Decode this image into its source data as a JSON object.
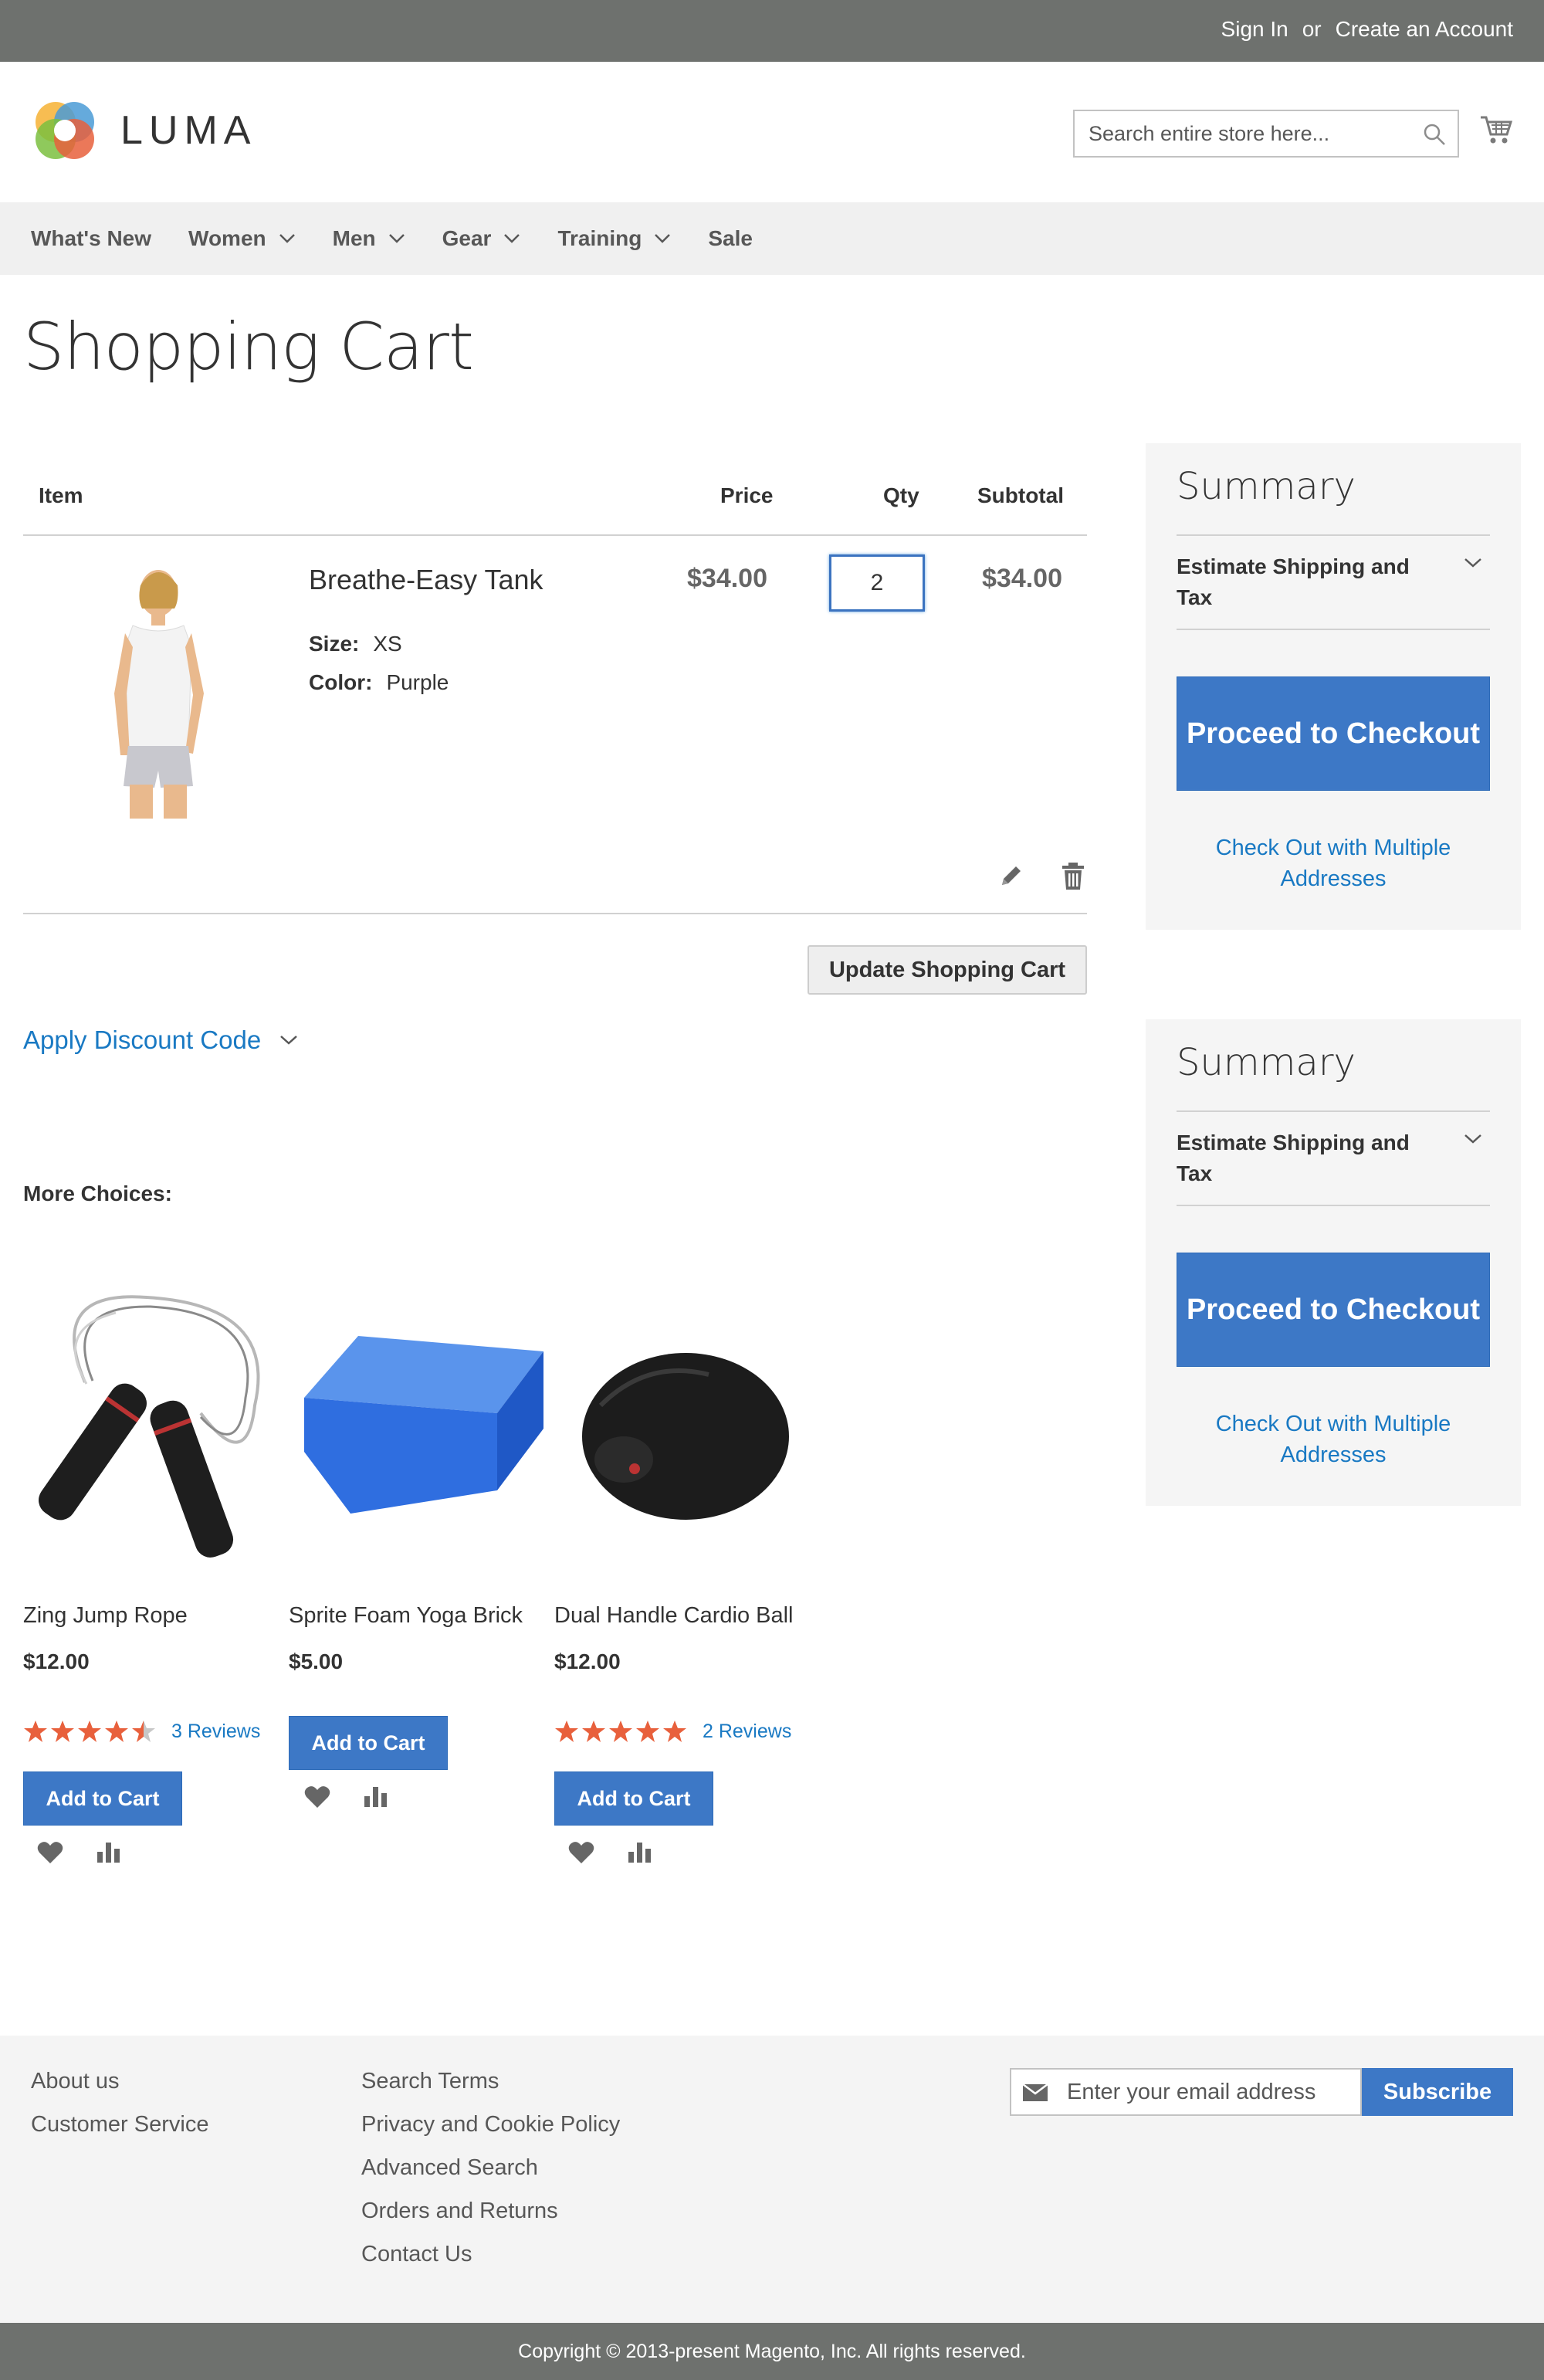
{
  "top_bar": {
    "sign_in": "Sign In",
    "or": "or",
    "create_account": "Create an Account"
  },
  "header": {
    "logo_text": "LUMA",
    "search": {
      "placeholder": "Search entire store here..."
    }
  },
  "nav": {
    "items": [
      {
        "label": "What's New",
        "has_dropdown": false
      },
      {
        "label": "Women",
        "has_dropdown": true
      },
      {
        "label": "Men",
        "has_dropdown": true
      },
      {
        "label": "Gear",
        "has_dropdown": true
      },
      {
        "label": "Training",
        "has_dropdown": true
      },
      {
        "label": "Sale",
        "has_dropdown": false
      }
    ]
  },
  "page": {
    "title": "Shopping Cart"
  },
  "cart": {
    "columns": {
      "item": "Item",
      "price": "Price",
      "qty": "Qty",
      "subtotal": "Subtotal"
    },
    "items": [
      {
        "name": "Breathe-Easy Tank",
        "price": "$34.00",
        "qty": "2",
        "subtotal": "$34.00",
        "options": [
          {
            "label": "Size:",
            "value": "XS"
          },
          {
            "label": "Color:",
            "value": "Purple"
          }
        ]
      }
    ],
    "update_button": "Update Shopping Cart",
    "discount_label": "Apply Discount Code"
  },
  "summary": [
    {
      "title": "Summary",
      "shipping_label": "Estimate Shipping and Tax",
      "checkout_button": "Proceed to Checkout",
      "multi_address_link": "Check Out with Multiple Addresses"
    },
    {
      "title": "Summary",
      "shipping_label": "Estimate Shipping and Tax",
      "checkout_button": "Proceed to Checkout",
      "multi_address_link": "Check Out with Multiple Addresses"
    }
  ],
  "more_choices": {
    "title": "More Choices:",
    "products": [
      {
        "name": "Zing Jump Rope",
        "price": "$12.00",
        "rating_stars": 4.5,
        "reviews": "3 Reviews",
        "add_to_cart": "Add to Cart"
      },
      {
        "name": "Sprite Foam Yoga Brick",
        "price": "$5.00",
        "rating_stars": null,
        "reviews": null,
        "add_to_cart": "Add to Cart"
      },
      {
        "name": "Dual Handle Cardio Ball",
        "price": "$12.00",
        "rating_stars": 5,
        "reviews": "2 Reviews",
        "add_to_cart": "Add to Cart"
      }
    ]
  },
  "footer": {
    "col1": [
      "About us",
      "Customer Service"
    ],
    "col2": [
      "Search Terms",
      "Privacy and Cookie Policy",
      "Advanced Search",
      "Orders and Returns",
      "Contact Us"
    ],
    "newsletter": {
      "placeholder": "Enter your email address",
      "button": "Subscribe"
    },
    "copyright": "Copyright © 2013-present Magento, Inc. All rights reserved."
  },
  "colors": {
    "top_bar_bg": "#6e716e",
    "primary_button": "#3d78c6",
    "link": "#1979c3",
    "star": "#e8603c",
    "nav_bg": "#f0f0f0",
    "summary_bg": "#f5f5f5"
  },
  "icons": [
    "luma-logo-icon",
    "search-icon",
    "cart-icon",
    "chevron-down-icon",
    "edit-pencil-icon",
    "trash-icon",
    "heart-icon",
    "compare-icon",
    "mail-icon",
    "star-icon"
  ]
}
